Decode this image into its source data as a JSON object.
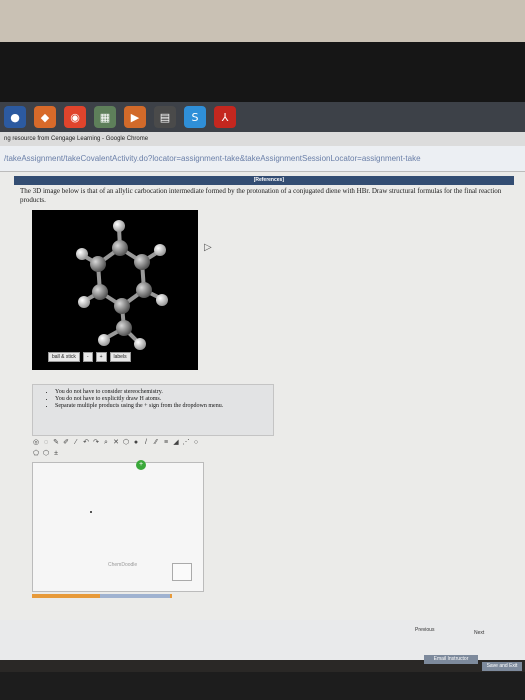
{
  "taskbar": {
    "icons": [
      "chrome-icon",
      "calendar-icon",
      "play-icon",
      "skype-icon",
      "acrobat-icon"
    ]
  },
  "window": {
    "title": "ng resource from Cengage Learning - Google Chrome"
  },
  "address": {
    "url": "/takeAssignment/takeCovalentActivity.do?locator=assignment-take&takeAssignmentSessionLocator=assignment-take"
  },
  "references": {
    "label": "[References]"
  },
  "question": {
    "text": "The 3D image below is that of an allylic carbocation intermediate formed by the protonation of a conjugated diene with HBr. Draw structural formulas for the final reaction products."
  },
  "viewer": {
    "mode": "ball & stick",
    "labels": "labels"
  },
  "notes": {
    "items": [
      "You do not have to consider stereochemistry.",
      "You do not have to explicitly draw H atoms.",
      "Separate multiple products using the + sign from the dropdown menu."
    ]
  },
  "editor": {
    "brand": "ChemDoodle"
  },
  "nav": {
    "previous": "Previous",
    "next": "Next",
    "email": "Email Instructor",
    "save": "Save and Exit"
  },
  "colors": {
    "refs_bar": "#334d72",
    "progress": "#e79a3a"
  }
}
